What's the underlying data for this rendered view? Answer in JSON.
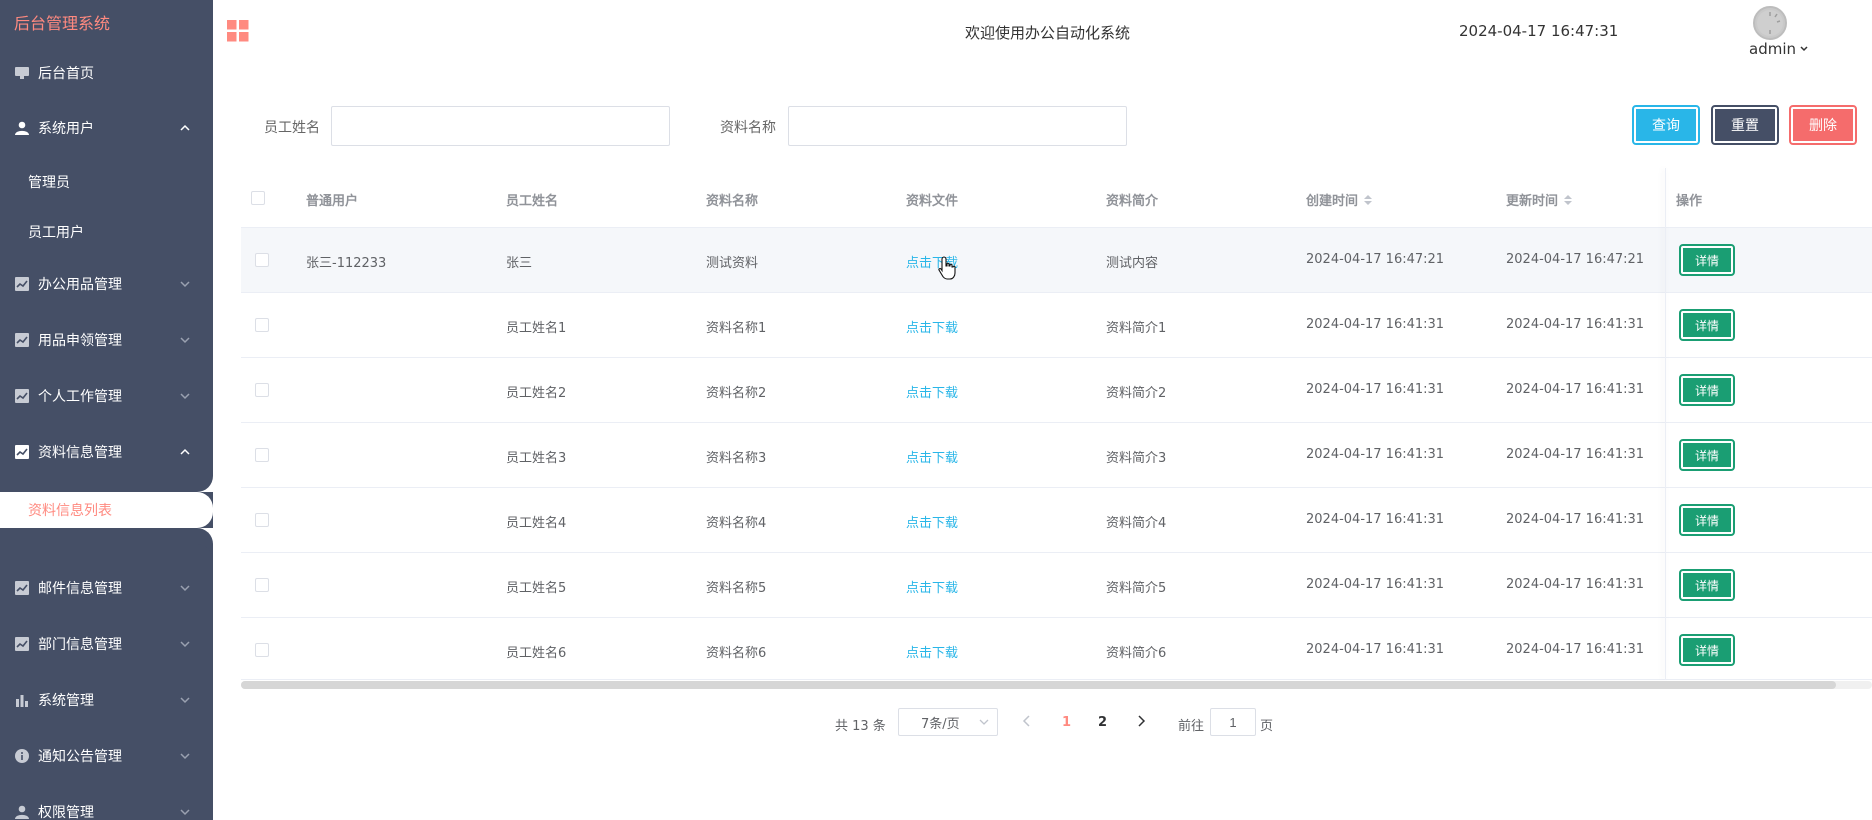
{
  "sidebar": {
    "brand": "后台管理系统",
    "items": [
      {
        "label": "后台首页"
      },
      {
        "label": "系统用户"
      },
      {
        "label": "管理员"
      },
      {
        "label": "员工用户"
      },
      {
        "label": "办公用品管理"
      },
      {
        "label": "用品申领管理"
      },
      {
        "label": "个人工作管理"
      },
      {
        "label": "资料信息管理"
      },
      {
        "label": "资料信息列表"
      },
      {
        "label": "邮件信息管理"
      },
      {
        "label": "部门信息管理"
      },
      {
        "label": "系统管理"
      },
      {
        "label": "通知公告管理"
      },
      {
        "label": "权限管理"
      }
    ]
  },
  "topbar": {
    "welcome": "欢迎使用办公自动化系统",
    "datetime": "2024-04-17 16:47:31",
    "user": "admin"
  },
  "search": {
    "employee_label": "员工姓名",
    "employee_value": "",
    "material_label": "资料名称",
    "material_value": "",
    "query": "查询",
    "reset": "重置",
    "delete": "删除"
  },
  "table": {
    "columns": [
      "普通用户",
      "员工姓名",
      "资料名称",
      "资料文件",
      "资料简介",
      "创建时间",
      "更新时间",
      "操作"
    ],
    "rows": [
      {
        "user": "张三-112233",
        "name": "张三",
        "material": "测试资料",
        "file": "点击下载",
        "intro": "测试内容",
        "created": "2024-04-17 16:47:21",
        "updated": "2024-04-17 16:47:21",
        "action": "详情"
      },
      {
        "user": "",
        "name": "员工姓名1",
        "material": "资料名称1",
        "file": "点击下载",
        "intro": "资料简介1",
        "created": "2024-04-17 16:41:31",
        "updated": "2024-04-17 16:41:31",
        "action": "详情"
      },
      {
        "user": "",
        "name": "员工姓名2",
        "material": "资料名称2",
        "file": "点击下载",
        "intro": "资料简介2",
        "created": "2024-04-17 16:41:31",
        "updated": "2024-04-17 16:41:31",
        "action": "详情"
      },
      {
        "user": "",
        "name": "员工姓名3",
        "material": "资料名称3",
        "file": "点击下载",
        "intro": "资料简介3",
        "created": "2024-04-17 16:41:31",
        "updated": "2024-04-17 16:41:31",
        "action": "详情"
      },
      {
        "user": "",
        "name": "员工姓名4",
        "material": "资料名称4",
        "file": "点击下载",
        "intro": "资料简介4",
        "created": "2024-04-17 16:41:31",
        "updated": "2024-04-17 16:41:31",
        "action": "详情"
      },
      {
        "user": "",
        "name": "员工姓名5",
        "material": "资料名称5",
        "file": "点击下载",
        "intro": "资料简介5",
        "created": "2024-04-17 16:41:31",
        "updated": "2024-04-17 16:41:31",
        "action": "详情"
      },
      {
        "user": "",
        "name": "员工姓名6",
        "material": "资料名称6",
        "file": "点击下载",
        "intro": "资料简介6",
        "created": "2024-04-17 16:41:31",
        "updated": "2024-04-17 16:41:31",
        "action": "详情"
      }
    ]
  },
  "pagination": {
    "total": "共 13 条",
    "page_size": "7条/页",
    "pages": [
      "1",
      "2"
    ],
    "goto_prefix": "前往",
    "goto_value": "1",
    "goto_suffix": "页"
  },
  "colors": {
    "sidebar_bg": "#454f66",
    "accent": "#ff8a80",
    "link": "#29b6e8",
    "detail": "#1a9e73",
    "danger": "#f56c6c"
  }
}
